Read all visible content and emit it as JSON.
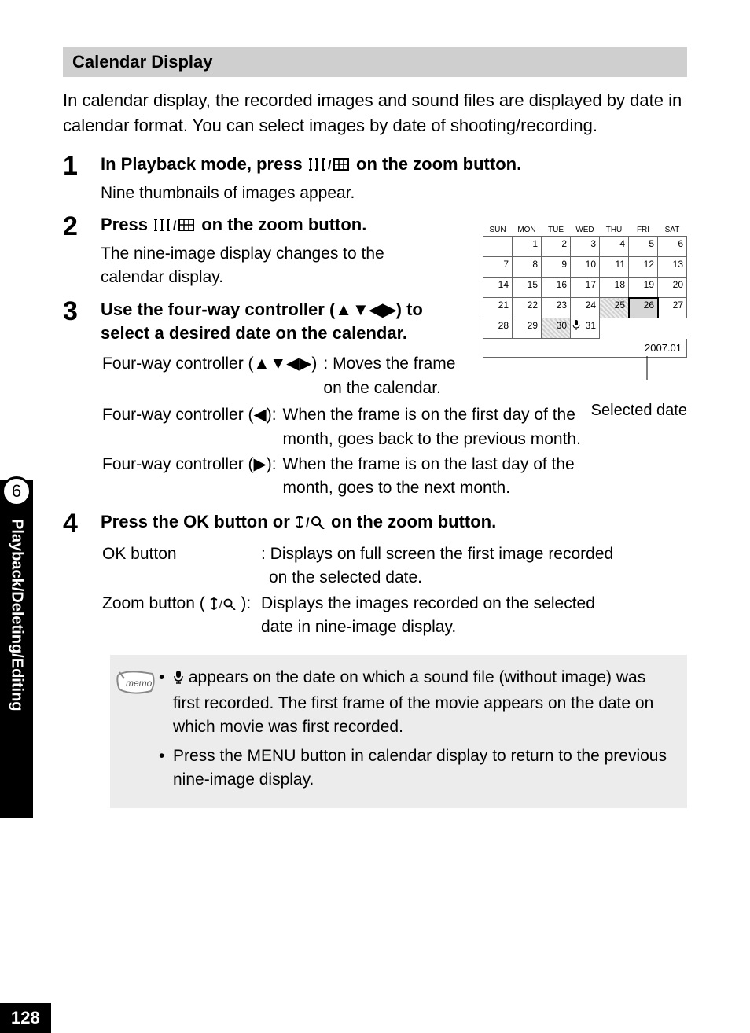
{
  "section_title": "Calendar Display",
  "intro": "In calendar display, the recorded images and sound files are displayed by date in calendar format. You can select images by date of shooting/recording.",
  "steps": {
    "s1": {
      "num": "1",
      "title_a": "In Playback mode, press ",
      "title_b": " on the zoom button.",
      "desc": "Nine thumbnails of images appear."
    },
    "s2": {
      "num": "2",
      "title_a": "Press ",
      "title_b": " on the zoom button.",
      "desc": "The nine-image display changes to the calendar display."
    },
    "s3": {
      "num": "3",
      "title_a": "Use the four-way controller (",
      "title_b": ") to select a desired date on the calendar.",
      "row1_l": "Four-way controller (▲▼◀▶)",
      "row1_r1": ": Moves the frame",
      "row1_r2": "on the calendar.",
      "row2_l": "Four-way controller (◀):",
      "row2_r1": "When the frame is on the first day of the",
      "row2_r2": "month, goes back to the previous month.",
      "row3_l": "Four-way controller (▶):",
      "row3_r1": "When the frame is on the last day of the",
      "row3_r2": "month, goes to the next month."
    },
    "s4": {
      "num": "4",
      "title_a": "Press the OK button or ",
      "title_b": " on the zoom button.",
      "row1_l": "OK button",
      "row1_r1": ": Displays on full screen the first image recorded",
      "row1_r2": "on the selected date.",
      "row2_l_a": "Zoom button ( ",
      "row2_l_b": "):",
      "row2_r1": "Displays the images recorded on the selected",
      "row2_r2": "date in nine-image display."
    }
  },
  "memo": {
    "li1_b": " appears on the date on which a sound file (without image) was first recorded. The first frame of the movie appears on the date on which movie was first recorded.",
    "li2": "Press the MENU button in calendar display to return to the previous nine-image display."
  },
  "calendar": {
    "days": [
      "SUN",
      "MON",
      "TUE",
      "WED",
      "THU",
      "FRI",
      "SAT"
    ],
    "weeks": [
      [
        "",
        "1",
        "2",
        "3",
        "4",
        "5",
        "6"
      ],
      [
        "7",
        "8",
        "9",
        "10",
        "11",
        "12",
        "13"
      ],
      [
        "14",
        "15",
        "16",
        "17",
        "18",
        "19",
        "20"
      ],
      [
        "21",
        "22",
        "23",
        "24",
        "25",
        "26",
        "27"
      ],
      [
        "28",
        "29",
        "30",
        "31",
        "",
        "",
        ""
      ]
    ],
    "footer": "2007.01",
    "caption": "Selected date"
  },
  "tab": {
    "chapter": "6",
    "label": "Playback/Deleting/Editing"
  },
  "page_number": "128"
}
